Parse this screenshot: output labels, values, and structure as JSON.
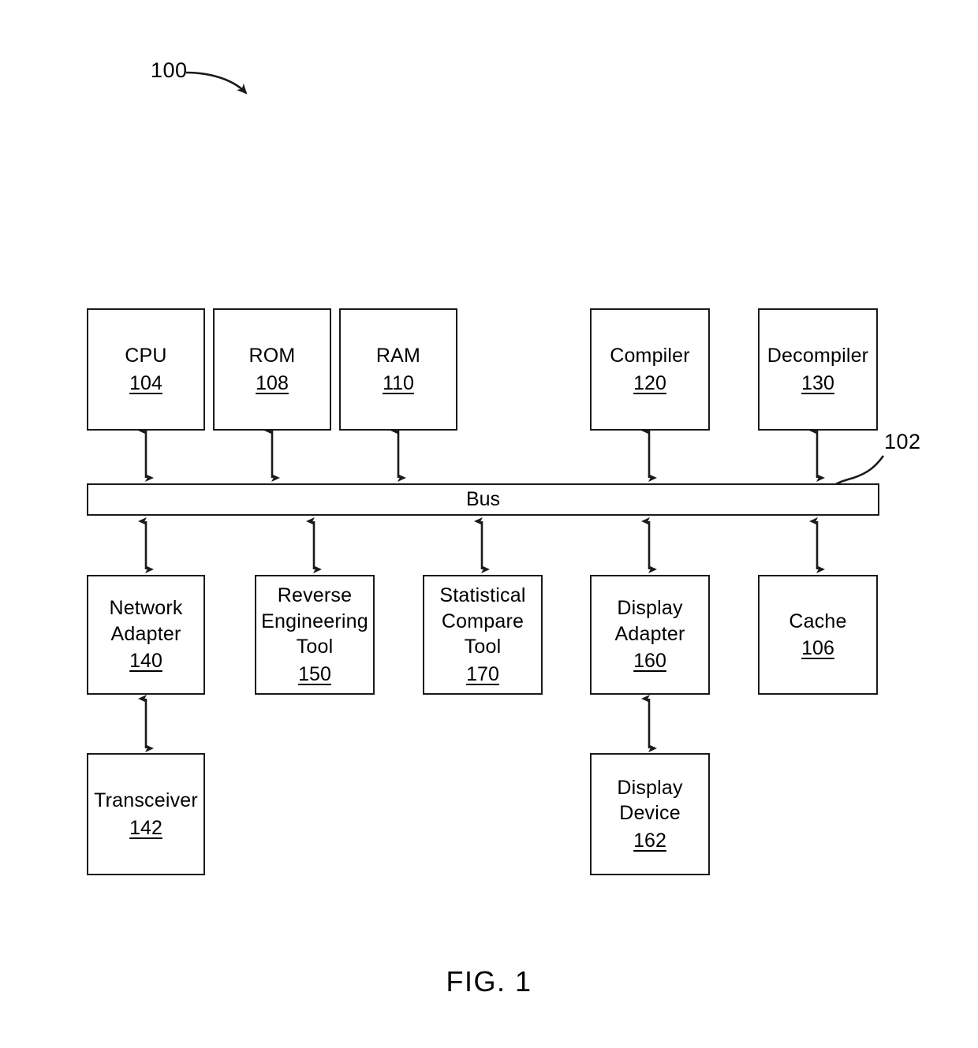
{
  "figure": {
    "caption": "FIG. 1",
    "system_ref": "100",
    "bus_ref": "102",
    "bus_label": "Bus"
  },
  "nodes": [
    {
      "id": "cpu",
      "label": "CPU",
      "ref": "104"
    },
    {
      "id": "rom",
      "label": "ROM",
      "ref": "108"
    },
    {
      "id": "ram",
      "label": "RAM",
      "ref": "110"
    },
    {
      "id": "compiler",
      "label": "Compiler",
      "ref": "120"
    },
    {
      "id": "decompiler",
      "label": "Decompiler",
      "ref": "130"
    },
    {
      "id": "network-adapter",
      "label": "Network\nAdapter",
      "ref": "140"
    },
    {
      "id": "reverse-tool",
      "label": "Reverse\nEngineering\nTool",
      "ref": "150"
    },
    {
      "id": "stat-tool",
      "label": "Statistical\nCompare\nTool",
      "ref": "170"
    },
    {
      "id": "display-adapter",
      "label": "Display\nAdapter",
      "ref": "160"
    },
    {
      "id": "cache",
      "label": "Cache",
      "ref": "106"
    },
    {
      "id": "transceiver",
      "label": "Transceiver",
      "ref": "142"
    },
    {
      "id": "display-device",
      "label": "Display\nDevice",
      "ref": "162"
    }
  ],
  "connections": [
    {
      "from": "cpu",
      "to": "bus",
      "style": "double-arrow"
    },
    {
      "from": "rom",
      "to": "bus",
      "style": "double-arrow"
    },
    {
      "from": "ram",
      "to": "bus",
      "style": "double-arrow"
    },
    {
      "from": "compiler",
      "to": "bus",
      "style": "double-arrow"
    },
    {
      "from": "decompiler",
      "to": "bus",
      "style": "double-arrow"
    },
    {
      "from": "bus",
      "to": "network-adapter",
      "style": "double-arrow"
    },
    {
      "from": "bus",
      "to": "reverse-tool",
      "style": "double-arrow"
    },
    {
      "from": "bus",
      "to": "stat-tool",
      "style": "double-arrow"
    },
    {
      "from": "bus",
      "to": "display-adapter",
      "style": "double-arrow"
    },
    {
      "from": "bus",
      "to": "cache",
      "style": "double-arrow"
    },
    {
      "from": "network-adapter",
      "to": "transceiver",
      "style": "double-arrow"
    },
    {
      "from": "display-adapter",
      "to": "display-device",
      "style": "double-arrow"
    }
  ],
  "colors": {
    "stroke": "#1a1a1a",
    "background": "#ffffff"
  }
}
